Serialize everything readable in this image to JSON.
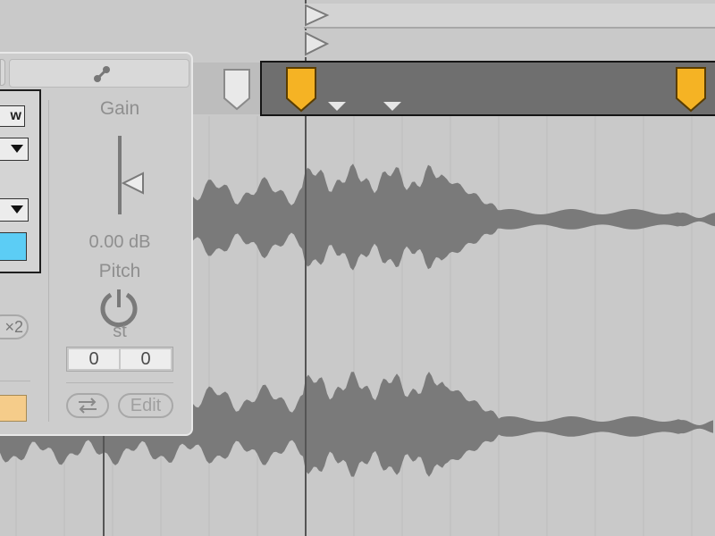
{
  "clip_view": {
    "warp_button_label": "w",
    "dropdown_arrow_icon": "triangle-down-icon",
    "color_swatch": "#5ccdf5",
    "half_speed_label": "×2",
    "secondary_swatch": "#f5cc8a",
    "link_icon": "link-icon"
  },
  "sample": {
    "gain_label": "Gain",
    "gain_value": "0.00 dB",
    "pitch_label": "Pitch",
    "pitch_unit": "st",
    "coarse_value": "0",
    "fine_value": "0",
    "swap_icon": "swap-arrows-icon",
    "edit_label": "Edit"
  },
  "colors": {
    "waveform": "#7a7a7a",
    "warp_marker": "#f5b324",
    "selection_bg": "#6f6f6f",
    "background": "#c9c9c9"
  }
}
